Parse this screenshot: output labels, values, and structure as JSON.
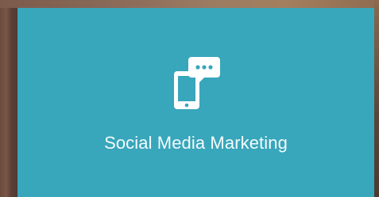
{
  "service_card": {
    "title": "Social Media Marketing",
    "icon": "mobile-chat-icon",
    "background_color": "#38a6bb",
    "text_color": "#f4fbfc"
  }
}
